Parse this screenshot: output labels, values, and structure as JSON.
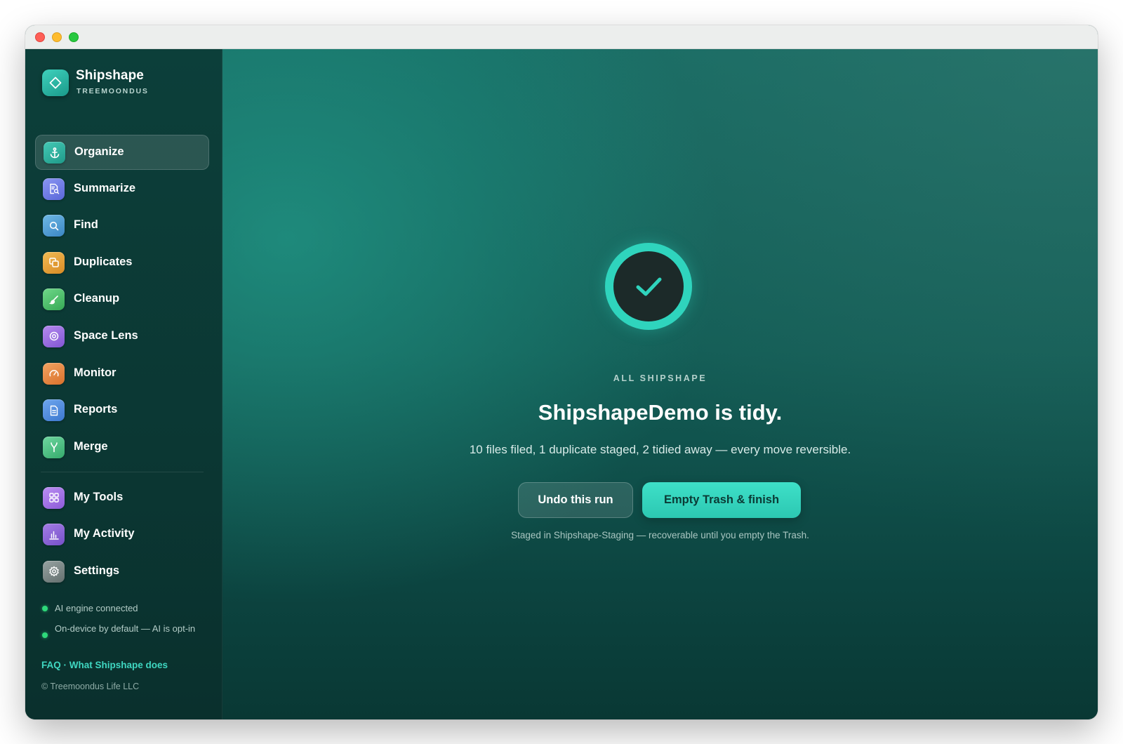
{
  "window": {
    "controls": [
      "close",
      "minimize",
      "zoom"
    ]
  },
  "brand": {
    "name": "Shipshape",
    "subtitle": "TREEMOONDUS",
    "icon": "diamond-icon"
  },
  "sidebar": {
    "items": [
      {
        "label": "Organize",
        "icon": "anchor-icon",
        "color": "#2fb3a1",
        "active": true
      },
      {
        "label": "Summarize",
        "icon": "document-search-icon",
        "color": "#6b7be8",
        "active": false
      },
      {
        "label": "Find",
        "icon": "search-icon",
        "color": "#4d9fd6",
        "active": false
      },
      {
        "label": "Duplicates",
        "icon": "copy-icon",
        "color": "#e3a23c",
        "active": false
      },
      {
        "label": "Cleanup",
        "icon": "brush-icon",
        "color": "#4fc26a",
        "active": false
      },
      {
        "label": "Space Lens",
        "icon": "target-icon",
        "color": "#9b6ee0",
        "active": false
      },
      {
        "label": "Monitor",
        "icon": "gauge-icon",
        "color": "#ea8a3e",
        "active": false
      },
      {
        "label": "Reports",
        "icon": "report-icon",
        "color": "#4f8fe0",
        "active": false
      },
      {
        "label": "Merge",
        "icon": "merge-icon",
        "color": "#48c482",
        "active": false
      }
    ],
    "secondary_items": [
      {
        "label": "My Tools",
        "icon": "grid-icon",
        "color": "#a070e6"
      },
      {
        "label": "My Activity",
        "icon": "bar-chart-icon",
        "color": "#8c63d8"
      },
      {
        "label": "Settings",
        "icon": "gear-icon",
        "color": "#7c8787"
      }
    ],
    "status": [
      {
        "text": "AI engine connected"
      },
      {
        "text": "On-device by default — AI is opt-in"
      }
    ],
    "links": {
      "faq": "FAQ",
      "separator": "·",
      "about": "What Shipshape does"
    },
    "copyright": "© Treemoondus Life LLC"
  },
  "main": {
    "icon": "checkmark-icon",
    "eyebrow": "ALL SHIPSHAPE",
    "headline": "ShipshapeDemo is tidy.",
    "summary": "10 files filed, 1 duplicate staged, 2 tidied away — every move reversible.",
    "undo_label": "Undo this run",
    "finish_label": "Empty Trash & finish",
    "footnote": "Staged in Shipshape-Staging — recoverable until you empty the Trash."
  },
  "colors": {
    "accent": "#2fd4bd",
    "sidebar_bg": "#0c3f3a",
    "main_bg": "#135d56",
    "status_dot": "#2ed97a"
  }
}
